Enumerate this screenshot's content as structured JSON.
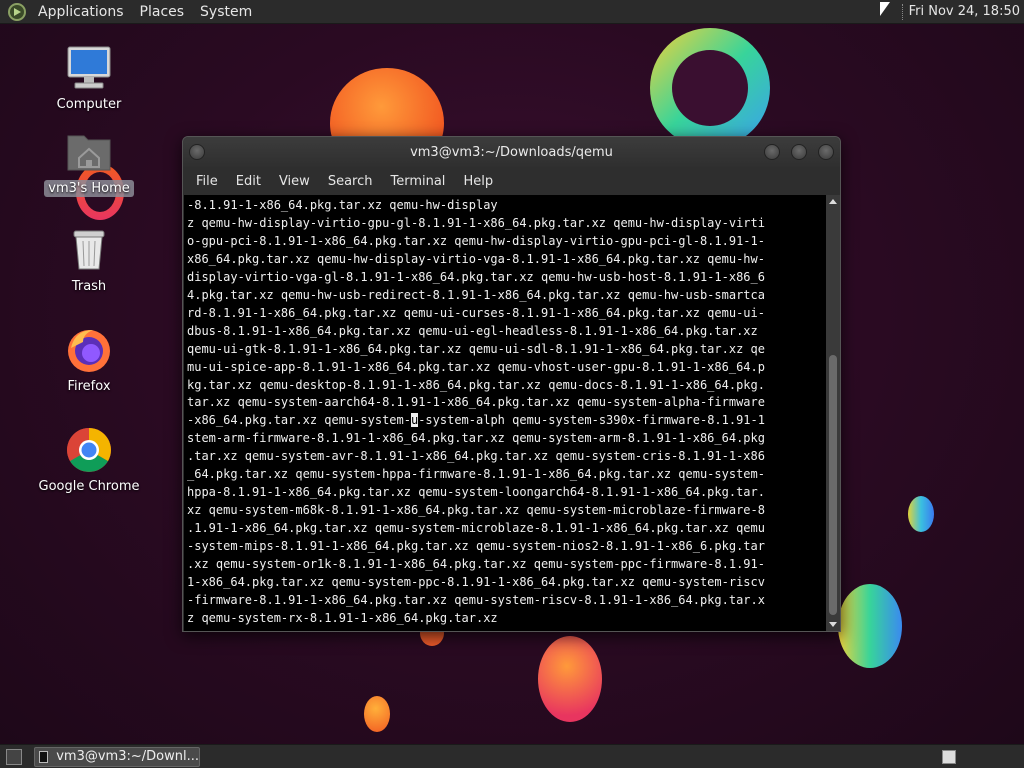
{
  "top_panel": {
    "menus": [
      "Applications",
      "Places",
      "System"
    ],
    "clock": "Fri Nov 24, 18:50"
  },
  "desktop_icons": [
    {
      "label": "Computer",
      "icon": "computer-icon"
    },
    {
      "label": "vm3's Home",
      "icon": "home-folder-icon",
      "selected": true
    },
    {
      "label": "Trash",
      "icon": "trash-icon"
    },
    {
      "label": "Firefox",
      "icon": "firefox-icon"
    },
    {
      "label": "Google Chrome",
      "icon": "chrome-icon"
    }
  ],
  "terminal": {
    "title": "vm3@vm3:~/Downloads/qemu",
    "menu": [
      "File",
      "Edit",
      "View",
      "Search",
      "Terminal",
      "Help"
    ],
    "lines": [
      "-8.1.91-1-x86_64.pkg.tar.xz qemu-hw-display",
      "z qemu-hw-display-virtio-gpu-gl-8.1.91-1-x86_64.pkg.tar.xz qemu-hw-display-virti",
      "o-gpu-pci-8.1.91-1-x86_64.pkg.tar.xz qemu-hw-display-virtio-gpu-pci-gl-8.1.91-1-",
      "x86_64.pkg.tar.xz qemu-hw-display-virtio-vga-8.1.91-1-x86_64.pkg.tar.xz qemu-hw-",
      "display-virtio-vga-gl-8.1.91-1-x86_64.pkg.tar.xz qemu-hw-usb-host-8.1.91-1-x86_6",
      "4.pkg.tar.xz qemu-hw-usb-redirect-8.1.91-1-x86_64.pkg.tar.xz qemu-hw-usb-smartca",
      "rd-8.1.91-1-x86_64.pkg.tar.xz qemu-ui-curses-8.1.91-1-x86_64.pkg.tar.xz qemu-ui-",
      "dbus-8.1.91-1-x86_64.pkg.tar.xz qemu-ui-egl-headless-8.1.91-1-x86_64.pkg.tar.xz",
      "qemu-ui-gtk-8.1.91-1-x86_64.pkg.tar.xz qemu-ui-sdl-8.1.91-1-x86_64.pkg.tar.xz qe",
      "mu-ui-spice-app-8.1.91-1-x86_64.pkg.tar.xz qemu-vhost-user-gpu-8.1.91-1-x86_64.p",
      "kg.tar.xz qemu-desktop-8.1.91-1-x86_64.pkg.tar.xz qemu-docs-8.1.91-1-x86_64.pkg.",
      "tar.xz qemu-system-aarch64-8.1.91-1-x86_64.pkg.tar.xz qemu-system-alpha-firmware",
      "-x86_64.pkg.tar.xz qemu-system-",
      "-system-alph qemu-system-s390x-firmware-8.1.91-1",
      "stem-arm-firmware-8.1.91-1-x86_64.pkg.tar.xz qemu-system-arm-8.1.91-1-x86_64.pkg",
      ".tar.xz qemu-system-avr-8.1.91-1-x86_64.pkg.tar.xz qemu-system-cris-8.1.91-1-x86",
      "_64.pkg.tar.xz qemu-system-hppa-firmware-8.1.91-1-x86_64.pkg.tar.xz qemu-system-",
      "hppa-8.1.91-1-x86_64.pkg.tar.xz qemu-system-loongarch64-8.1.91-1-x86_64.pkg.tar.",
      "xz qemu-system-m68k-8.1.91-1-x86_64.pkg.tar.xz qemu-system-microblaze-firmware-8",
      ".1.91-1-x86_64.pkg.tar.xz qemu-system-microblaze-8.1.91-1-x86_64.pkg.tar.xz qemu",
      "-system-mips-8.1.91-1-x86_64.pkg.tar.xz qemu-system-nios2-8.1.91-1-x86_6.pkg.tar",
      ".xz qemu-system-or1k-8.1.91-1-x86_64.pkg.tar.xz qemu-system-ppc-firmware-8.1.91-",
      "1-x86_64.pkg.tar.xz qemu-system-ppc-8.1.91-1-x86_64.pkg.tar.xz qemu-system-riscv",
      "-firmware-8.1.91-1-x86_64.pkg.tar.xz qemu-system-riscv-8.1.91-1-x86_64.pkg.tar.x",
      "z qemu-system-rx-8.1.91-1-x86_64.pkg.tar.xz"
    ],
    "cursor_char": "u"
  },
  "taskbar": {
    "task_label": "vm3@vm3:~/Downl..."
  }
}
